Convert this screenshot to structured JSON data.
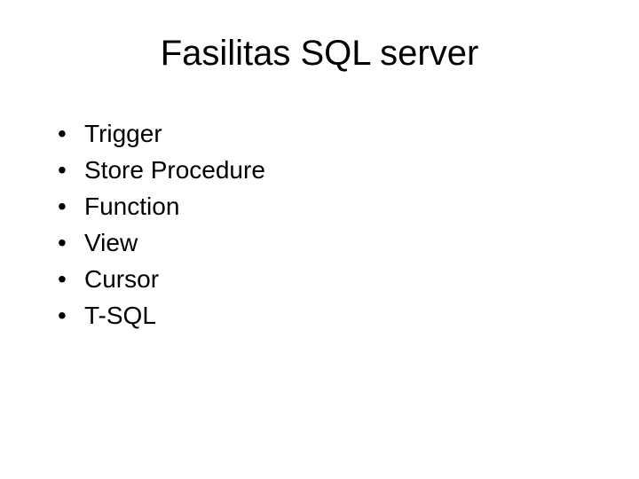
{
  "slide": {
    "title": "Fasilitas SQL server",
    "bullets": [
      {
        "text": "Trigger"
      },
      {
        "text": "Store Procedure"
      },
      {
        "text": "Function"
      },
      {
        "text": "View"
      },
      {
        "text": "Cursor"
      },
      {
        "text": "T-SQL"
      }
    ]
  }
}
